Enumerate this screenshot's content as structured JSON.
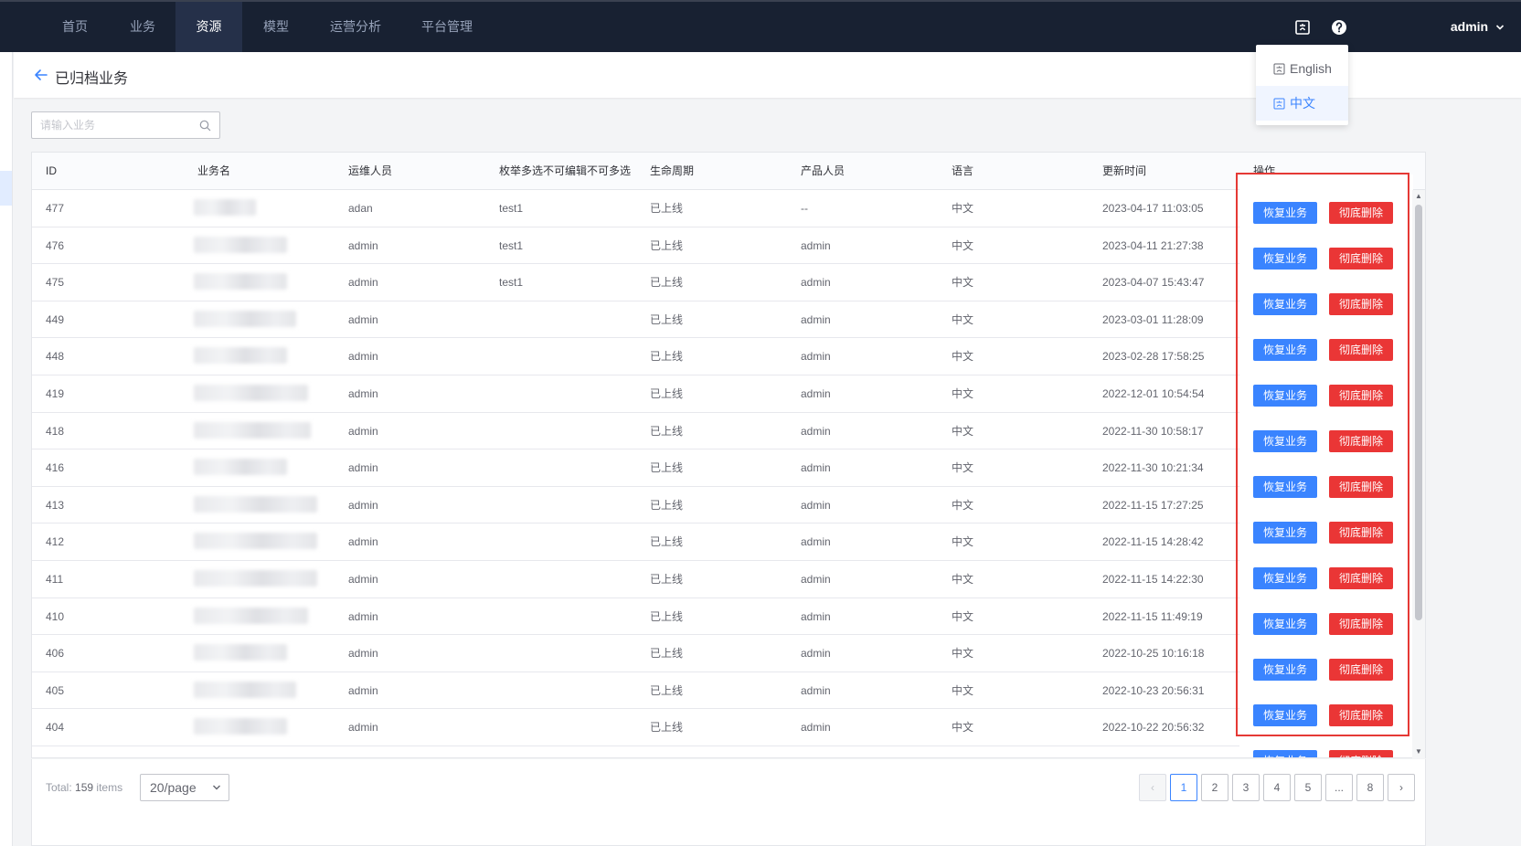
{
  "nav": {
    "items": [
      "首页",
      "业务",
      "资源",
      "模型",
      "运营分析",
      "平台管理"
    ],
    "active_index": 2,
    "user": "admin"
  },
  "language_menu": {
    "options": [
      "English",
      "中文"
    ],
    "selected": "中文"
  },
  "page": {
    "title": "已归档业务"
  },
  "search": {
    "placeholder": "请输入业务"
  },
  "table": {
    "columns": [
      "ID",
      "业务名",
      "运维人员",
      "枚举多选不可编辑不可多选",
      "生命周期",
      "产品人员",
      "语言",
      "更新时间",
      "操作"
    ],
    "rows": [
      {
        "id": "477",
        "maintainer": "adan",
        "enum": "test1",
        "lifecycle": "已上线",
        "product": "--",
        "lang": "中文",
        "updated": "2023-04-17 11:03:05"
      },
      {
        "id": "476",
        "maintainer": "admin",
        "enum": "test1",
        "lifecycle": "已上线",
        "product": "admin",
        "lang": "中文",
        "updated": "2023-04-11 21:27:38"
      },
      {
        "id": "475",
        "maintainer": "admin",
        "enum": "test1",
        "lifecycle": "已上线",
        "product": "admin",
        "lang": "中文",
        "updated": "2023-04-07 15:43:47"
      },
      {
        "id": "449",
        "maintainer": "admin",
        "enum": "",
        "lifecycle": "已上线",
        "product": "admin",
        "lang": "中文",
        "updated": "2023-03-01 11:28:09"
      },
      {
        "id": "448",
        "maintainer": "admin",
        "enum": "",
        "lifecycle": "已上线",
        "product": "admin",
        "lang": "中文",
        "updated": "2023-02-28 17:58:25"
      },
      {
        "id": "419",
        "maintainer": "admin",
        "enum": "",
        "lifecycle": "已上线",
        "product": "admin",
        "lang": "中文",
        "updated": "2022-12-01 10:54:54"
      },
      {
        "id": "418",
        "maintainer": "admin",
        "enum": "",
        "lifecycle": "已上线",
        "product": "admin",
        "lang": "中文",
        "updated": "2022-11-30 10:58:17"
      },
      {
        "id": "416",
        "maintainer": "admin",
        "enum": "",
        "lifecycle": "已上线",
        "product": "admin",
        "lang": "中文",
        "updated": "2022-11-30 10:21:34"
      },
      {
        "id": "413",
        "maintainer": "admin",
        "enum": "",
        "lifecycle": "已上线",
        "product": "admin",
        "lang": "中文",
        "updated": "2022-11-15 17:27:25"
      },
      {
        "id": "412",
        "maintainer": "admin",
        "enum": "",
        "lifecycle": "已上线",
        "product": "admin",
        "lang": "中文",
        "updated": "2022-11-15 14:28:42"
      },
      {
        "id": "411",
        "maintainer": "admin",
        "enum": "",
        "lifecycle": "已上线",
        "product": "admin",
        "lang": "中文",
        "updated": "2022-11-15 14:22:30"
      },
      {
        "id": "410",
        "maintainer": "admin",
        "enum": "",
        "lifecycle": "已上线",
        "product": "admin",
        "lang": "中文",
        "updated": "2022-11-15 11:49:19"
      },
      {
        "id": "406",
        "maintainer": "admin",
        "enum": "",
        "lifecycle": "已上线",
        "product": "admin",
        "lang": "中文",
        "updated": "2022-10-25 10:16:18"
      },
      {
        "id": "405",
        "maintainer": "admin",
        "enum": "",
        "lifecycle": "已上线",
        "product": "admin",
        "lang": "中文",
        "updated": "2022-10-23 20:56:31"
      },
      {
        "id": "404",
        "maintainer": "admin",
        "enum": "",
        "lifecycle": "已上线",
        "product": "admin",
        "lang": "中文",
        "updated": "2022-10-22 20:56:32"
      }
    ],
    "restore_label": "恢复业务",
    "delete_label": "彻底删除"
  },
  "pagination": {
    "total_label": "Total:",
    "total": "159",
    "items_label": "items",
    "page_size": "20/page",
    "pages": [
      "1",
      "2",
      "3",
      "4",
      "5",
      "...",
      "8"
    ],
    "current": "1",
    "prev": "‹",
    "next": "›"
  },
  "colors": {
    "nav_bg": "#182132",
    "primary": "#3a84ff",
    "danger": "#ea3636",
    "highlight_box": "#e53935"
  }
}
